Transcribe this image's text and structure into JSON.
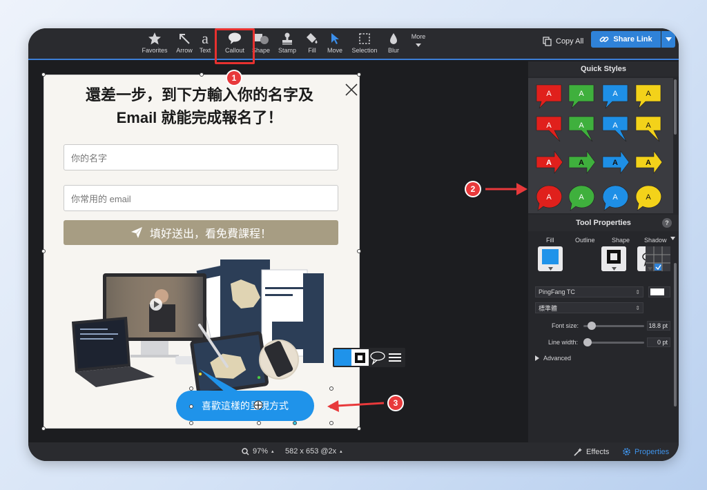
{
  "toolbar": {
    "tools": [
      {
        "id": "favorites",
        "label": "Favorites",
        "icon": "star-icon"
      },
      {
        "id": "arrow",
        "label": "Arrow",
        "icon": "arrow-icon"
      },
      {
        "id": "text",
        "label": "Text",
        "icon": "text-icon"
      },
      {
        "id": "callout",
        "label": "Callout",
        "icon": "callout-icon"
      },
      {
        "id": "shape",
        "label": "Shape",
        "icon": "shape-icon"
      },
      {
        "id": "stamp",
        "label": "Stamp",
        "icon": "stamp-icon"
      },
      {
        "id": "fill",
        "label": "Fill",
        "icon": "fill-icon"
      },
      {
        "id": "move",
        "label": "Move",
        "icon": "move-icon"
      },
      {
        "id": "selection",
        "label": "Selection",
        "icon": "selection-icon"
      },
      {
        "id": "blur",
        "label": "Blur",
        "icon": "blur-icon"
      },
      {
        "id": "more",
        "label": "More",
        "icon": "chevron-down-icon"
      }
    ],
    "text_glyph": "a",
    "copy_all": "Copy All",
    "share_link": "Share Link"
  },
  "annotations": {
    "badge1": "1",
    "badge2": "2",
    "badge3": "3",
    "color": "#e8393b"
  },
  "card": {
    "title_line1": "還差一步，到下方輸入你的名字及",
    "title_line2": "Email 就能完成報名了！",
    "name_placeholder": "你的名字",
    "email_placeholder": "你常用的 email",
    "submit_label": "填好送出，看免費課程！",
    "submit_color": "#a79d83"
  },
  "callout": {
    "text": "喜歡這樣的呈現方式",
    "color": "#1f93ea"
  },
  "panel": {
    "quick_styles_title": "Quick Styles",
    "quick_style_letter": "A",
    "quick_style_colors": [
      "#e0201c",
      "#3fb03d",
      "#1e8fe6",
      "#f3d21a"
    ],
    "tool_properties_title": "Tool Properties",
    "help": "?",
    "fill_label": "Fill",
    "outline_label": "Outline",
    "shape_label": "Shape",
    "shadow_label": "Shadow",
    "font_family": "PingFang TC",
    "font_style": "標準體",
    "font_size_label": "Font size:",
    "font_size_value": "18.8 pt",
    "line_width_label": "Line width:",
    "line_width_value": "0 pt",
    "advanced_label": "Advanced"
  },
  "bottom": {
    "zoom": "97%",
    "dimensions": "582 x 653 @2x",
    "effects": "Effects",
    "properties": "Properties"
  }
}
